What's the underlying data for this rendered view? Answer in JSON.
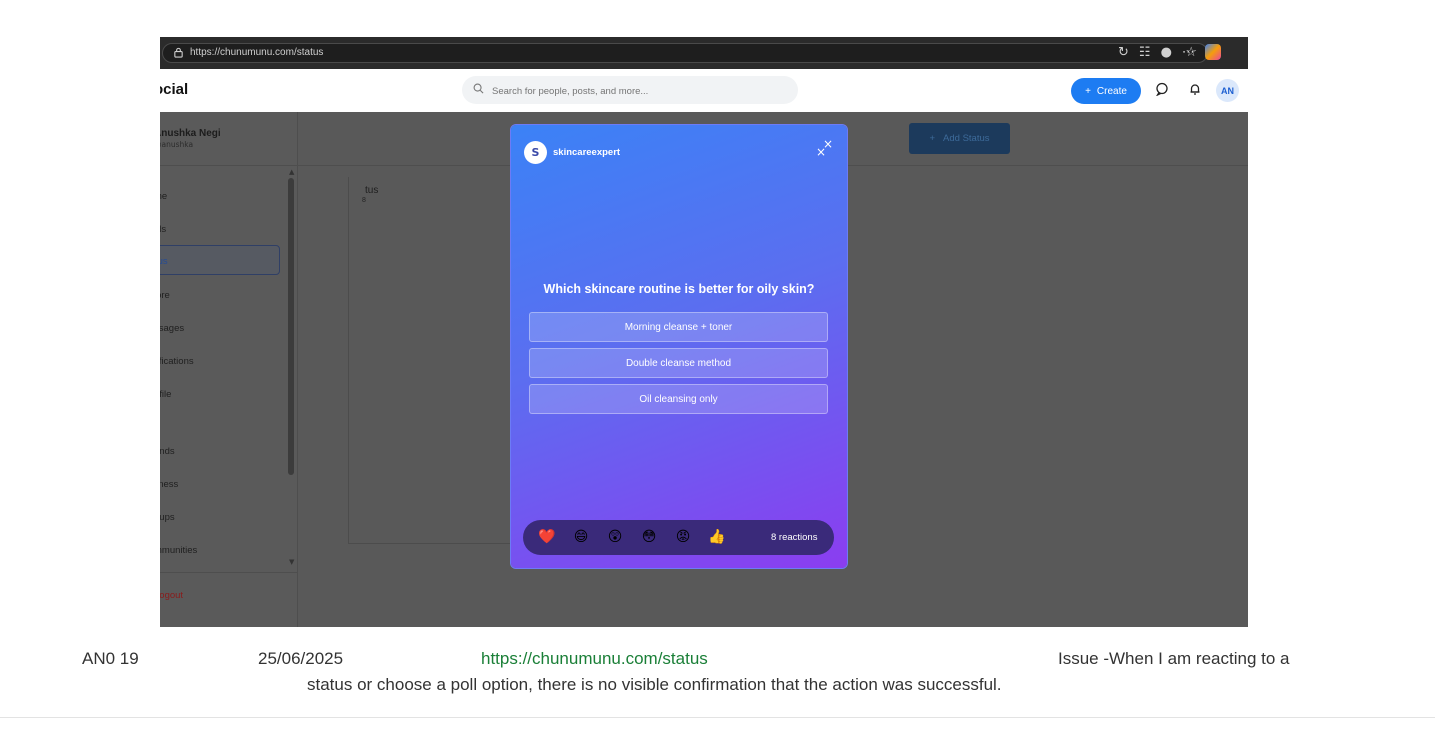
{
  "browser": {
    "url": "https://chunumunu.com/status"
  },
  "app": {
    "brand": "ocial",
    "search_placeholder": "Search for people, posts, and more...",
    "create_label": "Create",
    "avatar_initials": "AN",
    "add_status_label": "Add Status"
  },
  "sidebar": {
    "user_name": "Anushka Negi",
    "user_handle": "@anushka",
    "items": [
      {
        "label": "me"
      },
      {
        "label": "els"
      },
      {
        "label": "tus"
      },
      {
        "label": "lore"
      },
      {
        "label": "ssages"
      },
      {
        "label": "tifications"
      },
      {
        "label": "ofile"
      },
      {
        "label": "ends"
      },
      {
        "label": "llness"
      },
      {
        "label": "oups"
      },
      {
        "label": "mmunities"
      }
    ],
    "logout": "Logout"
  },
  "status_card": {
    "alt_text": "tus",
    "count": "8"
  },
  "modal": {
    "avatar_letter": "S",
    "username": "skincareexpert",
    "question": "Which skincare routine is better for oily skin?",
    "options": [
      {
        "label": "Morning cleanse + toner"
      },
      {
        "label": "Double cleanse method"
      },
      {
        "label": "Oil cleansing only"
      }
    ],
    "reactions": [
      {
        "icon": "heart-icon",
        "glyph": "❤️"
      },
      {
        "icon": "laughing-face-icon",
        "glyph": "😄"
      },
      {
        "icon": "surprised-face-icon",
        "glyph": "😲"
      },
      {
        "icon": "flushed-face-icon",
        "glyph": "😳"
      },
      {
        "icon": "angry-face-icon",
        "glyph": "😡"
      },
      {
        "icon": "thumbs-up-icon",
        "glyph": "👍"
      }
    ],
    "reaction_count": "8 reactions",
    "gradient_colors": [
      "#3b82f6",
      "#8b3df0"
    ]
  },
  "caption": {
    "id": "AN0 19",
    "date": "25/06/2025",
    "url": "https://chunumunu.com/status",
    "issue_line1": "Issue -When I am reacting  to a",
    "issue_line2": "status or choose a poll option, there is no visible confirmation that the action was successful."
  }
}
